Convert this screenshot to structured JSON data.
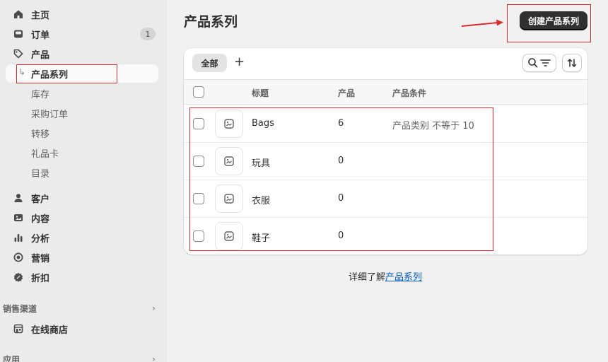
{
  "sidebar": {
    "items": [
      {
        "label": "主页",
        "icon": "home-icon"
      },
      {
        "label": "订单",
        "icon": "inbox-icon",
        "badge": "1"
      },
      {
        "label": "产品",
        "icon": "tag-icon"
      }
    ],
    "sub_items": [
      {
        "label": "产品系列",
        "active": true
      },
      {
        "label": "库存"
      },
      {
        "label": "采购订单"
      },
      {
        "label": "转移"
      },
      {
        "label": "礼品卡"
      },
      {
        "label": "目录"
      }
    ],
    "items2": [
      {
        "label": "客户",
        "icon": "person-icon"
      },
      {
        "label": "内容",
        "icon": "image-icon"
      },
      {
        "label": "分析",
        "icon": "bar-chart-icon"
      },
      {
        "label": "营销",
        "icon": "target-icon"
      },
      {
        "label": "折扣",
        "icon": "discount-icon"
      }
    ],
    "sales_channels": {
      "label": "销售渠道",
      "items": [
        {
          "label": "在线商店",
          "icon": "store-icon"
        }
      ]
    },
    "apps": {
      "label": "应用"
    }
  },
  "main": {
    "title": "产品系列",
    "create_button": "创建产品系列",
    "tabs": [
      {
        "label": "全部"
      }
    ],
    "add_tab": "+",
    "columns": [
      "标题",
      "产品",
      "产品条件"
    ],
    "rows": [
      {
        "title": "Bags",
        "products": "6",
        "condition": "产品类别 不等于 10"
      },
      {
        "title": "玩具",
        "products": "0",
        "condition": ""
      },
      {
        "title": "衣服",
        "products": "0",
        "condition": ""
      },
      {
        "title": "鞋子",
        "products": "0",
        "condition": ""
      }
    ],
    "footer_prefix": "详细了解",
    "footer_link": "产品系列"
  },
  "colors": {
    "annotation_red": "#d82c2c",
    "button_dark": "#303030",
    "link": "#005bd3"
  }
}
